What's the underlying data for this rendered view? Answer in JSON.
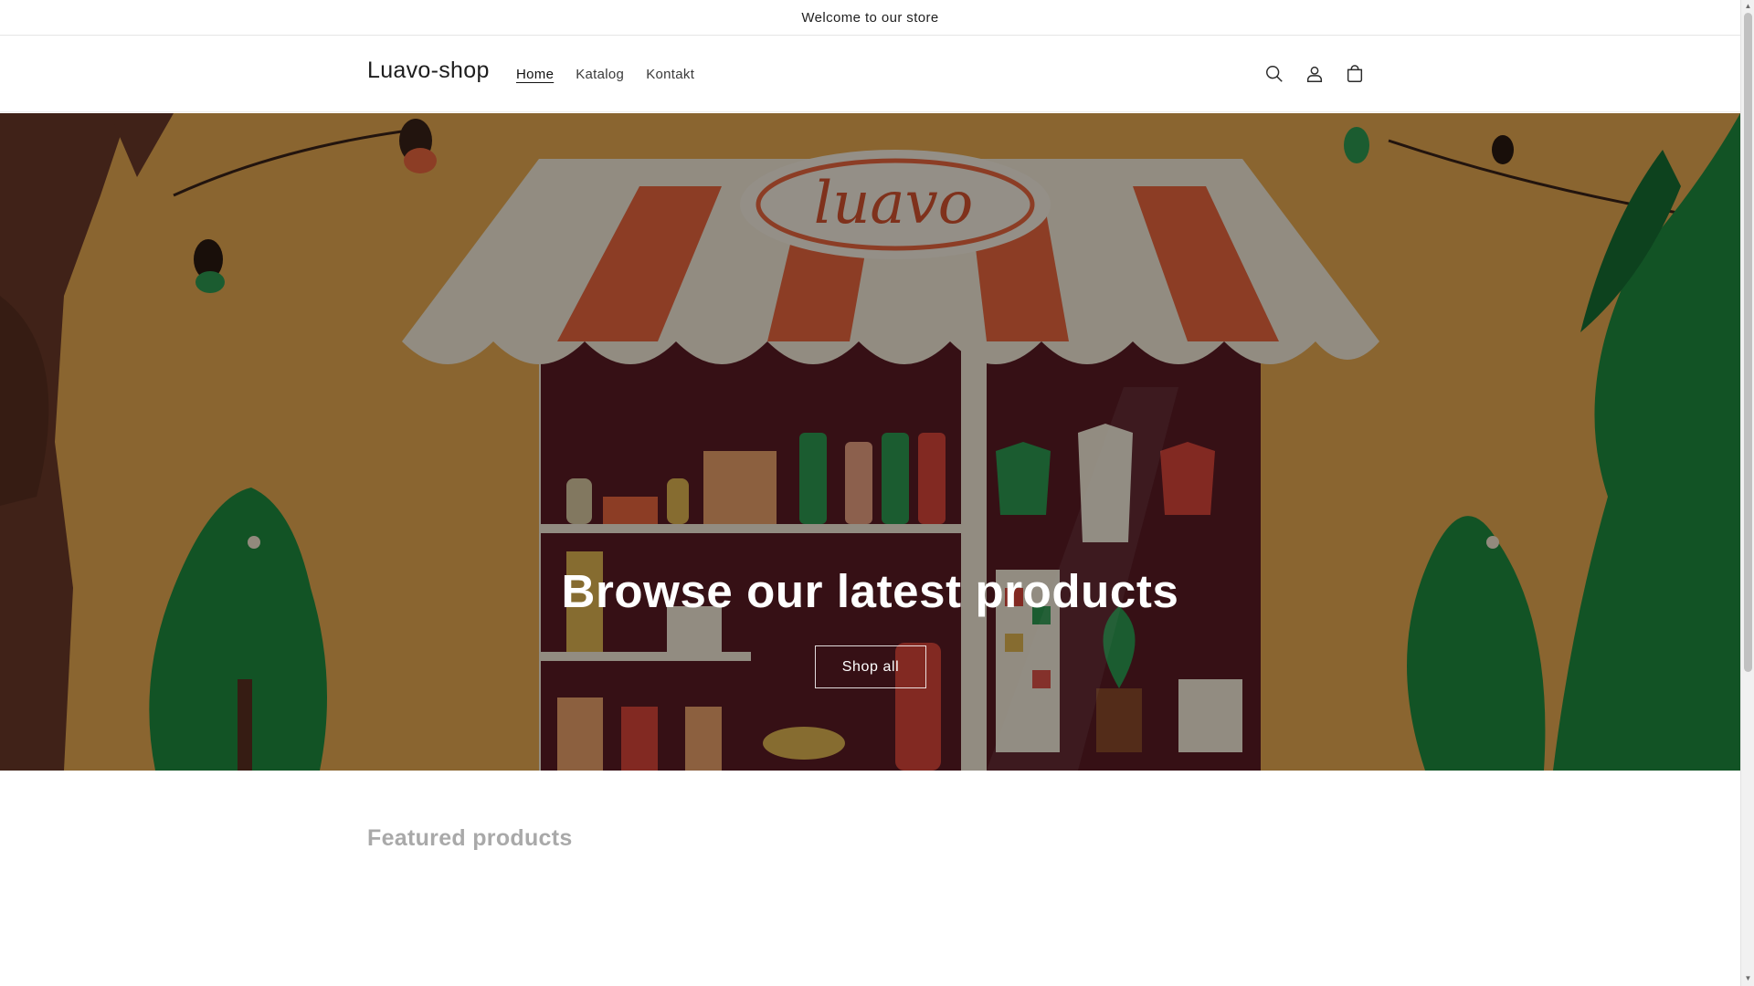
{
  "announcement": {
    "text": "Welcome to our store"
  },
  "header": {
    "logo": "Luavo-shop",
    "nav": [
      {
        "label": "Home",
        "active": true
      },
      {
        "label": "Katalog",
        "active": false
      },
      {
        "label": "Kontakt",
        "active": false
      }
    ],
    "icons": [
      "search-icon",
      "account-icon",
      "cart-icon"
    ]
  },
  "hero": {
    "title": "Browse our latest products",
    "button_label": "Shop all",
    "sign_text": "luavo"
  },
  "featured": {
    "title": "Featured products"
  },
  "colors": {
    "background_orange": "#e7a950",
    "awning_orange": "#e9663f",
    "tree_green": "#1f8a3f",
    "trunk_brown": "#6b3a28",
    "shop_interior": "#5a1b24"
  }
}
